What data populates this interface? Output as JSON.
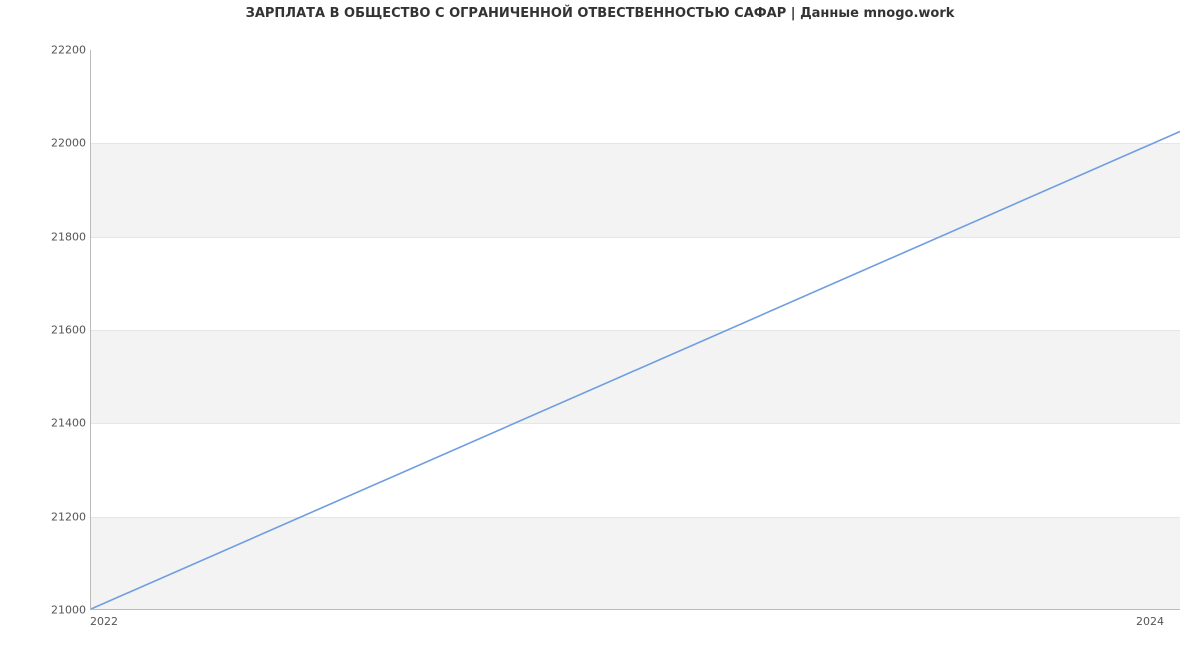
{
  "chart_data": {
    "type": "line",
    "title": "ЗАРПЛАТА В ОБЩЕСТВО С ОГРАНИЧЕННОЙ ОТВЕСТВЕННОСТЬЮ  САФАР | Данные mnogo.work",
    "xlabel": "",
    "ylabel": "",
    "x": [
      2022,
      2024
    ],
    "values": [
      21000,
      22025
    ],
    "xlim": [
      2022,
      2024
    ],
    "ylim": [
      21000,
      22200
    ],
    "xticks": [
      2022,
      2024
    ],
    "yticks": [
      21000,
      21200,
      21400,
      21600,
      21800,
      22000,
      22200
    ],
    "line_color": "#6f9ee0",
    "band_color": "#f3f3f3"
  }
}
